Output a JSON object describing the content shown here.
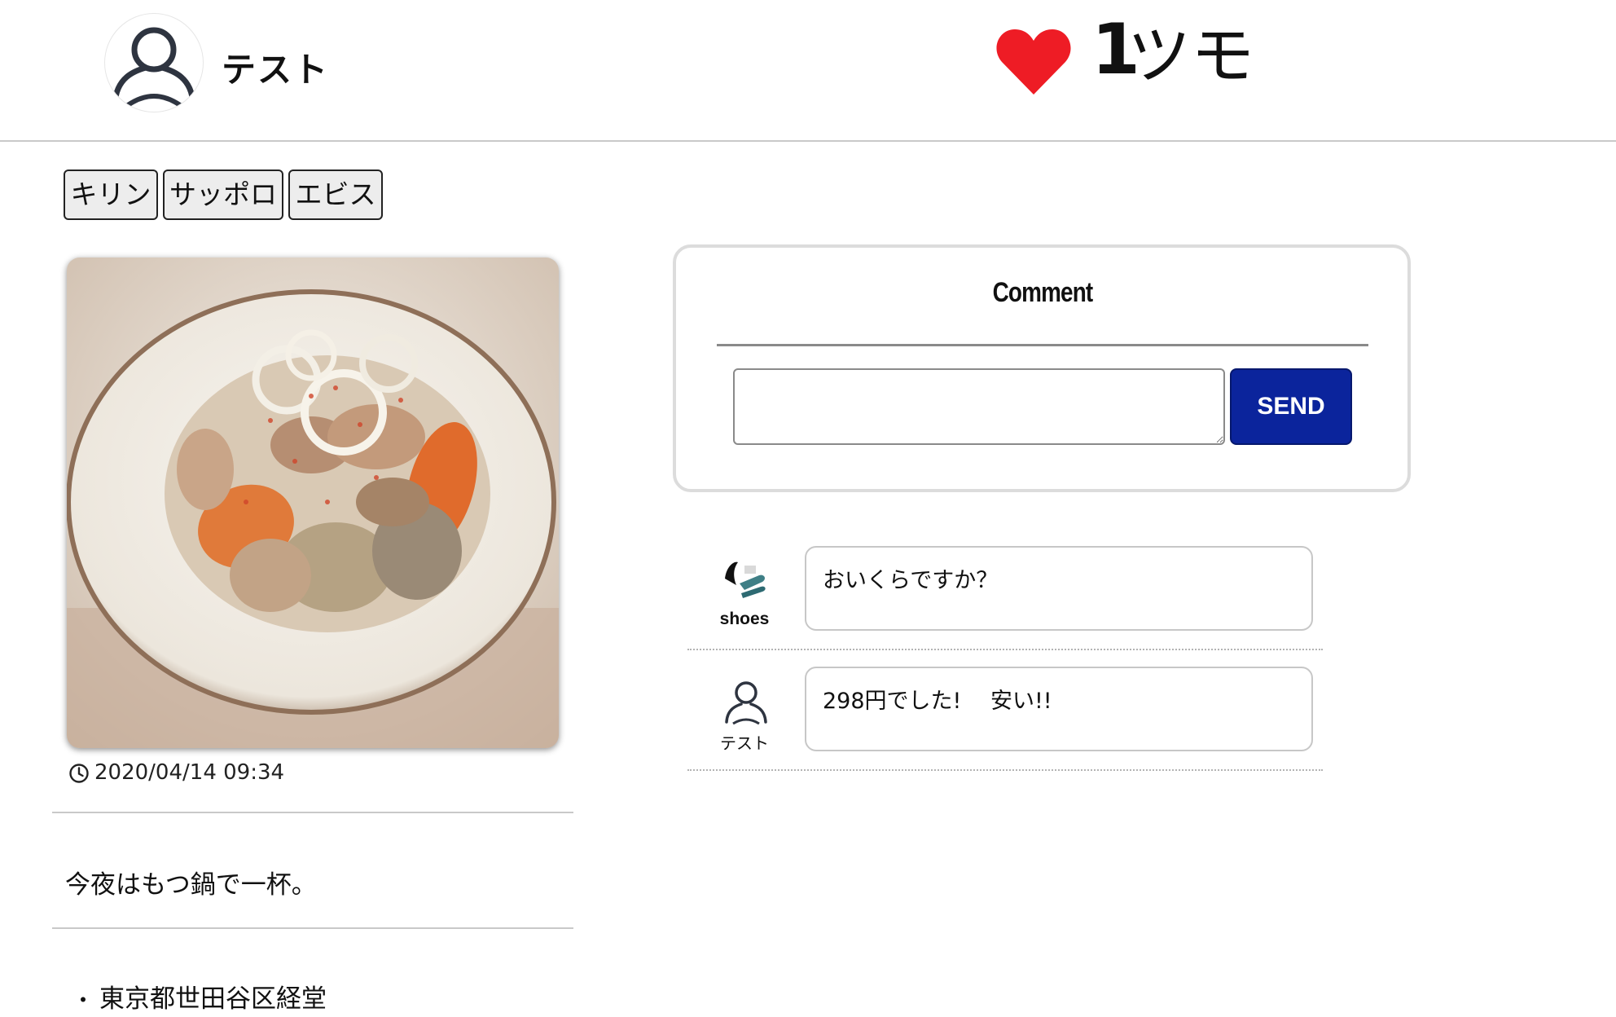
{
  "header": {
    "username": "テスト",
    "like_count": "1",
    "like_unit": "ツモ",
    "heart_color": "#ee1c25",
    "avatar_icon": "user-silhouette-icon"
  },
  "tags": [
    {
      "label": "キリン"
    },
    {
      "label": "サッポロ"
    },
    {
      "label": "エビス"
    }
  ],
  "post": {
    "photo_icon": "food-photo",
    "timestamp": "2020/04/14 09:34",
    "caption": "今夜はもつ鍋で一杯。",
    "location_bullet": "・",
    "location": "東京都世田谷区経堂"
  },
  "comment_form": {
    "title": "Comment",
    "input_value": "",
    "send_label": "SEND",
    "send_color": "#0b249c"
  },
  "comments": [
    {
      "user": "shoes",
      "text": "おいくらですか？"
    },
    {
      "user": "テスト",
      "text": "298円でした!　 安い!!"
    }
  ]
}
